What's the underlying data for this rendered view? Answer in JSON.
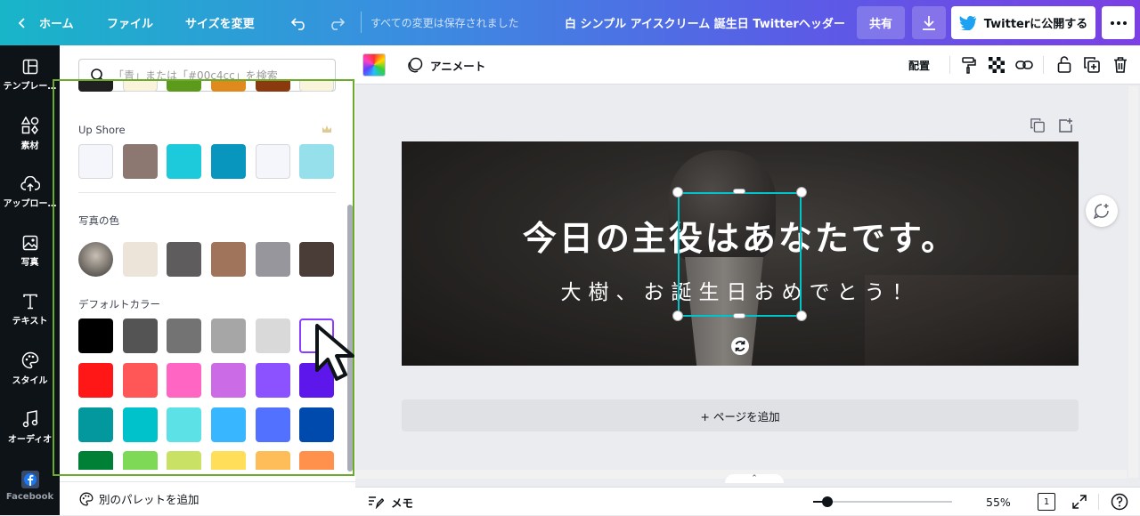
{
  "topbar": {
    "home": "ホーム",
    "file": "ファイル",
    "resize": "サイズを変更",
    "save_status": "すべての変更は保存されました",
    "doc_title": "白 シンプル アイスクリーム 誕生日 Twitterヘッダー",
    "share": "共有",
    "publish": "Twitterに公開する"
  },
  "rail": [
    {
      "label": "テンプレー…",
      "icon": "template-icon"
    },
    {
      "label": "素材",
      "icon": "elements-icon"
    },
    {
      "label": "アップロー…",
      "icon": "upload-icon"
    },
    {
      "label": "写真",
      "icon": "photo-icon"
    },
    {
      "label": "テキスト",
      "icon": "text-icon"
    },
    {
      "label": "スタイル",
      "icon": "palette-icon"
    },
    {
      "label": "オーディオ",
      "icon": "audio-icon"
    },
    {
      "label": "Facebook",
      "icon": "facebook-icon"
    }
  ],
  "panel": {
    "search_placeholder": "「青」または「#00c4cc」を検索",
    "top_row": [
      "#202020",
      "#fbf4dc",
      "#5c9a1c",
      "#e0891c",
      "#8a3a0e",
      "#fbf4dc"
    ],
    "upshore_label": "Up Shore",
    "upshore_colors": [
      "#f5f6fb",
      "#8c7870",
      "#1ccadc",
      "#0896be",
      "#f5f6fb",
      "#96e0ec"
    ],
    "photo_label": "写真の色",
    "photo_colors": [
      "#ece4d8",
      "#5e5c5c",
      "#a0745a",
      "#96969c",
      "#4a3c36"
    ],
    "default_label": "デフォルトカラー",
    "default_colors": [
      [
        "#000000",
        "#545454",
        "#737373",
        "#a6a6a6",
        "#d9d9d9",
        "#ffffff"
      ],
      [
        "#ff1616",
        "#ff5757",
        "#ff66c4",
        "#cb6ce6",
        "#8c52ff",
        "#5e17eb"
      ],
      [
        "#03989e",
        "#00c2cb",
        "#5ce1e6",
        "#38b6ff",
        "#5271ff",
        "#004aad"
      ],
      [
        "#008037",
        "#7ed957",
        "#c9e265",
        "#ffde59",
        "#ffbd59",
        "#ff914d"
      ]
    ],
    "add_palette": "別のパレットを追加"
  },
  "toolbar": {
    "animate": "アニメート",
    "arrange": "配置"
  },
  "design": {
    "headline": "今日の主役はあなたです。",
    "subline": "大樹、お誕生日おめでとう！"
  },
  "add_page": "+ ページを追加",
  "bottombar": {
    "notes": "メモ",
    "zoom": "55%",
    "page_count": "1"
  },
  "colors": {
    "accent": "#00c4cc",
    "highlight_green": "#6aab2a",
    "selected_swatch": "#8b3dff"
  }
}
